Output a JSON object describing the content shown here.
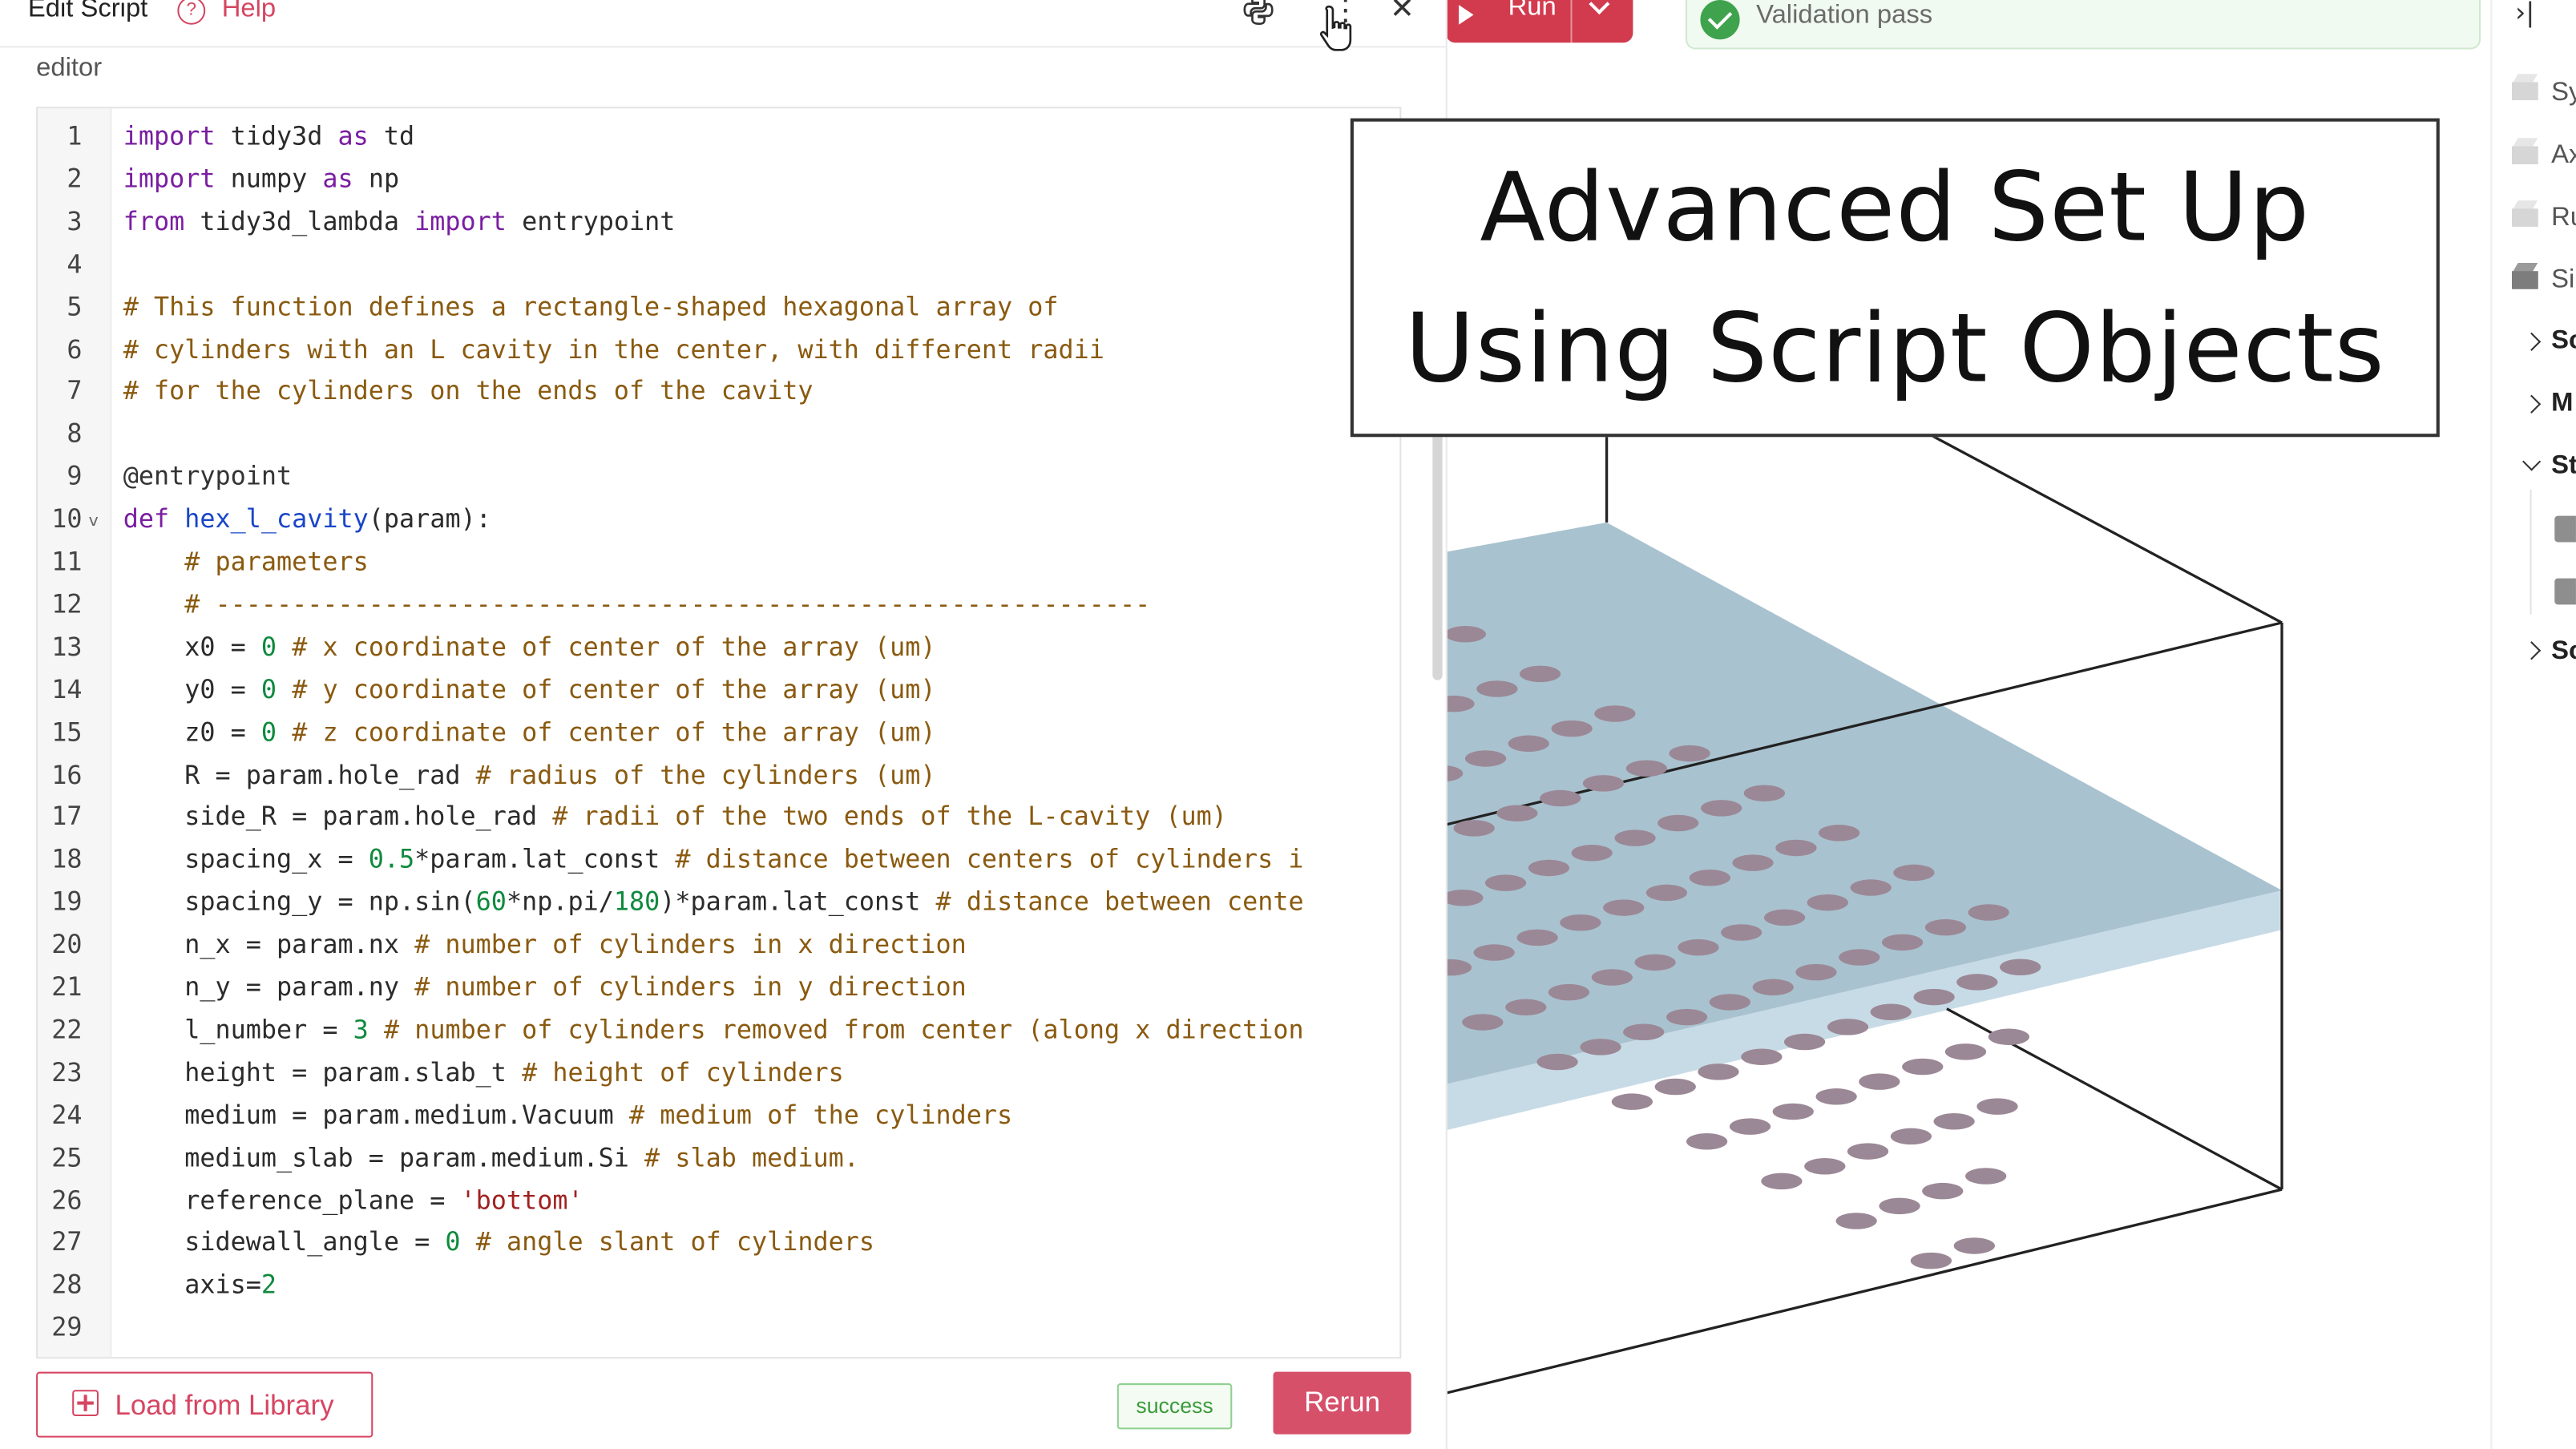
{
  "header": {
    "title": "Edit Script",
    "help_label": "Help"
  },
  "editor": {
    "label": "editor",
    "code": [
      [
        [
          "kw",
          "import"
        ],
        [
          "t",
          " tidy3d "
        ],
        [
          "kw",
          "as"
        ],
        [
          "t",
          " td"
        ]
      ],
      [
        [
          "kw",
          "import"
        ],
        [
          "t",
          " numpy "
        ],
        [
          "kw",
          "as"
        ],
        [
          "t",
          " np"
        ]
      ],
      [
        [
          "kw",
          "from"
        ],
        [
          "t",
          " tidy3d_lambda "
        ],
        [
          "kw",
          "import"
        ],
        [
          "t",
          " entrypoint"
        ]
      ],
      [],
      [
        [
          "cm",
          "# This function defines a rectangle-shaped hexagonal array of"
        ]
      ],
      [
        [
          "cm",
          "# cylinders with an L cavity in the center, with different radii"
        ]
      ],
      [
        [
          "cm",
          "# for the cylinders on the ends of the cavity"
        ]
      ],
      [],
      [
        [
          "deco",
          "@entrypoint"
        ]
      ],
      [
        [
          "kw",
          "def"
        ],
        [
          "t",
          " "
        ],
        [
          "fn",
          "hex_l_cavity"
        ],
        [
          "t",
          "(param):"
        ]
      ],
      [
        [
          "t",
          "    "
        ],
        [
          "cm",
          "# parameters"
        ]
      ],
      [
        [
          "t",
          "    "
        ],
        [
          "cm",
          "# -------------------------------------------------------------"
        ]
      ],
      [
        [
          "t",
          "    x0 = "
        ],
        [
          "num",
          "0"
        ],
        [
          "t",
          " "
        ],
        [
          "cm",
          "# x coordinate of center of the array (um)"
        ]
      ],
      [
        [
          "t",
          "    y0 = "
        ],
        [
          "num",
          "0"
        ],
        [
          "t",
          " "
        ],
        [
          "cm",
          "# y coordinate of center of the array (um)"
        ]
      ],
      [
        [
          "t",
          "    z0 = "
        ],
        [
          "num",
          "0"
        ],
        [
          "t",
          " "
        ],
        [
          "cm",
          "# z coordinate of center of the array (um)"
        ]
      ],
      [
        [
          "t",
          "    R = param.hole_rad "
        ],
        [
          "cm",
          "# radius of the cylinders (um)"
        ]
      ],
      [
        [
          "t",
          "    side_R = param.hole_rad "
        ],
        [
          "cm",
          "# radii of the two ends of the L-cavity (um)"
        ]
      ],
      [
        [
          "t",
          "    spacing_x = "
        ],
        [
          "num",
          "0.5"
        ],
        [
          "t",
          "*param.lat_const "
        ],
        [
          "cm",
          "# distance between centers of cylinders i"
        ]
      ],
      [
        [
          "t",
          "    spacing_y = np.sin("
        ],
        [
          "num",
          "60"
        ],
        [
          "t",
          "*np.pi/"
        ],
        [
          "num",
          "180"
        ],
        [
          "t",
          ")*param.lat_const "
        ],
        [
          "cm",
          "# distance between cente"
        ]
      ],
      [
        [
          "t",
          "    n_x = param.nx "
        ],
        [
          "cm",
          "# number of cylinders in x direction"
        ]
      ],
      [
        [
          "t",
          "    n_y = param.ny "
        ],
        [
          "cm",
          "# number of cylinders in y direction"
        ]
      ],
      [
        [
          "t",
          "    l_number = "
        ],
        [
          "num",
          "3"
        ],
        [
          "t",
          " "
        ],
        [
          "cm",
          "# number of cylinders removed from center (along x direction"
        ]
      ],
      [
        [
          "t",
          "    height = param.slab_t "
        ],
        [
          "cm",
          "# height of cylinders"
        ]
      ],
      [
        [
          "t",
          "    medium = param.medium.Vacuum "
        ],
        [
          "cm",
          "# medium of the cylinders"
        ]
      ],
      [
        [
          "t",
          "    medium_slab = param.medium.Si "
        ],
        [
          "cm",
          "# slab medium."
        ]
      ],
      [
        [
          "t",
          "    reference_plane = "
        ],
        [
          "str",
          "'bottom'"
        ]
      ],
      [
        [
          "t",
          "    sidewall_angle = "
        ],
        [
          "num",
          "0"
        ],
        [
          "t",
          " "
        ],
        [
          "cm",
          "# angle slant of cylinders"
        ]
      ],
      [
        [
          "t",
          "    axis="
        ],
        [
          "num",
          "2"
        ]
      ],
      []
    ]
  },
  "footer": {
    "load_label": "Load from Library",
    "status": "success",
    "rerun_label": "Rerun"
  },
  "toolbar": {
    "run_label": "Run",
    "validation_text": "Validation pass"
  },
  "tree": {
    "items": [
      "Sy",
      "Ax",
      "Ru",
      "Si"
    ],
    "groups": [
      "Sc",
      "M",
      "St",
      "Sc"
    ]
  },
  "overlay": {
    "line1": "Advanced Set Up",
    "line2": "Using Script Objects"
  },
  "colors": {
    "accent": "#d64561",
    "run": "#d23a4e",
    "slab": "#a9c2cf",
    "hole": "#9b8896"
  },
  "icons": {
    "help": "question-circle-icon",
    "python": "python-icon",
    "more": "vertical-dots-icon",
    "close": "close-icon",
    "play": "play-icon",
    "check": "check-circle-icon",
    "plus": "plus-square-icon"
  }
}
